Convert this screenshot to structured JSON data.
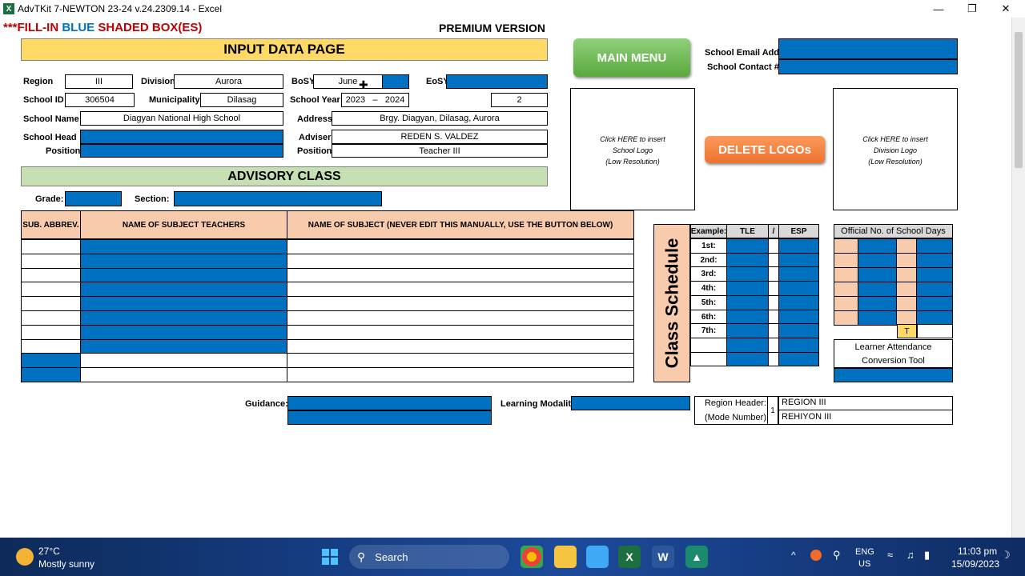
{
  "window": {
    "title": "AdvTKit 7-NEWTON  23-24  v.24.2309.14 - Excel",
    "app_letter": "X"
  },
  "header": {
    "fill_prefix": "***FILL-IN ",
    "fill_blue": "BLUE",
    "fill_suffix": " SHADED BOX(ES)",
    "premium": "PREMIUM VERSION",
    "input_title": "INPUT DATA PAGE"
  },
  "form": {
    "region_label": "Region",
    "region_value": "III",
    "division_label": "Division",
    "division_value": "Aurora",
    "bosy_label": "BoSY",
    "bosy_value": "June",
    "eosy_label": "EoSY",
    "schoolid_label": "School ID",
    "schoolid_value": "306504",
    "municipality_label": "Municipality",
    "municipality_value": "Dilasag",
    "schoolyear_label": "School Year",
    "sy_start": "2023",
    "sy_dash": "–",
    "sy_end": "2024",
    "extra_value": "2",
    "schoolname_label": "School Name",
    "schoolname_value": "Diagyan National High School",
    "address_label": "Address",
    "address_value": "Brgy. Diagyan, Dilasag, Aurora",
    "schoolhead_label": "School Head",
    "position_label": "Position",
    "adviser_label": "Adviser",
    "adviser_value": "REDEN S. VALDEZ",
    "adviser_pos_label": "Position",
    "adviser_pos_value": "Teacher III"
  },
  "advisory": {
    "title": "ADVISORY CLASS",
    "grade_label": "Grade:",
    "section_label": "Section:"
  },
  "subjects": {
    "col_abbrev": "SUB. ABBREV.",
    "col_teachers": "NAME OF SUBJECT TEACHERS",
    "col_subject": "NAME OF SUBJECT  (NEVER EDIT THIS MANUALLY, USE THE BUTTON BELOW)"
  },
  "buttons": {
    "main_menu": "MAIN MENU",
    "delete_logos": "DELETE LOGOs"
  },
  "contact": {
    "email_label": "School Email Add:",
    "contact_label": "School Contact #:"
  },
  "logos": {
    "school_line1": "Click HERE to insert",
    "school_line2": "School Logo",
    "school_line3": "(Low Resolution)",
    "division_line1": "Click HERE to insert",
    "division_line2": "Division Logo",
    "division_line3": "(Low Resolution)"
  },
  "schedule": {
    "vertical_title": "Class Schedule",
    "example_label": "Example:",
    "tle": "TLE",
    "slash": "/",
    "esp": "ESP",
    "rows": [
      "1st:",
      "2nd:",
      "3rd:",
      "4th:",
      "5th:",
      "6th:",
      "7th:"
    ]
  },
  "school_days": {
    "title": "Official No. of School Days",
    "t_label": "T"
  },
  "attendance": {
    "line1": "Learner Attendance",
    "line2": "Conversion Tool"
  },
  "bottom": {
    "guidance_label": "Guidance:",
    "modality_label": "Learning Modality:",
    "region_header_label": "Region Header:",
    "mode_number_label": "(Mode Number)",
    "mode_number": "1",
    "region_en": "REGION III",
    "region_fil": "REHIYON III"
  },
  "taskbar": {
    "temp": "27°C",
    "weather": "Mostly sunny",
    "search": "Search",
    "lang1": "ENG",
    "lang2": "US",
    "time": "11:03 pm",
    "date": "15/09/2023"
  },
  "colors": {
    "blue": "#0070c0",
    "yellow": "#ffd966",
    "green": "#c6e0b4",
    "peach": "#f8cbad",
    "red": "#c00000",
    "orange": "#f4b183"
  }
}
